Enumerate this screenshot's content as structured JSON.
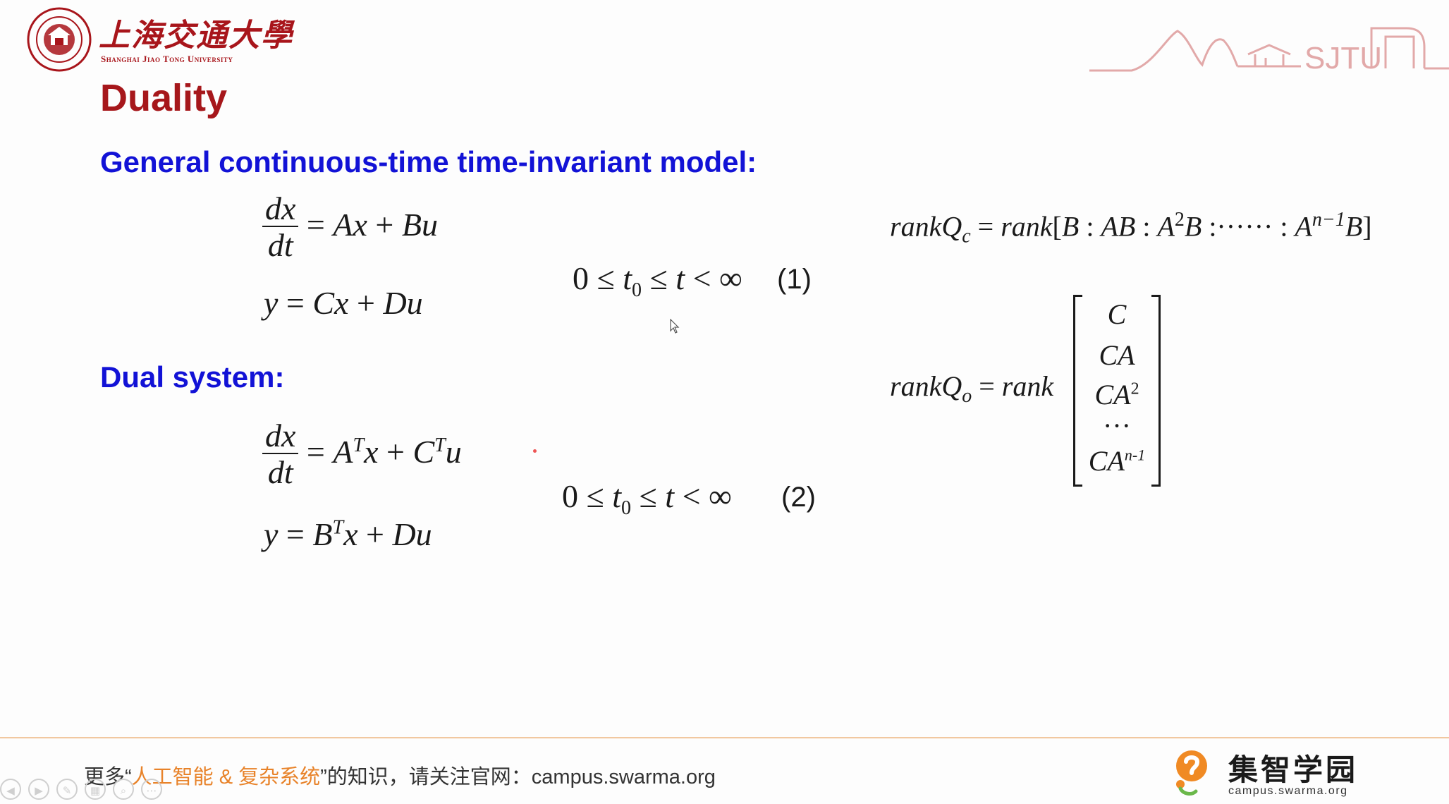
{
  "header": {
    "university_cn": "上海交通大學",
    "university_en": "Shanghai Jiao Tong University",
    "skyline_text": "SJTU",
    "logo_icon": "sjtu-seal-icon"
  },
  "slide": {
    "title": "Duality",
    "heading_general": "General continuous-time time-invariant model:",
    "heading_dual": "Dual system:",
    "eq1_number": "(1)",
    "eq2_number": "(2)"
  },
  "footer": {
    "prefix": "更多“",
    "highlight": "人工智能 & 复杂系统",
    "suffix": "”的知识，请关注官网：campus.swarma.org",
    "brand_name": "集智学园",
    "brand_url": "campus.swarma.org"
  },
  "toolbar": {
    "buttons": [
      "prev-icon",
      "next-icon",
      "pen-icon",
      "slides-icon",
      "zoom-icon",
      "more-icon"
    ]
  },
  "colors": {
    "title": "#a6171b",
    "heading": "#1212d6",
    "footer_accent": "#e8832a",
    "footer_line": "#f1c8a0"
  }
}
